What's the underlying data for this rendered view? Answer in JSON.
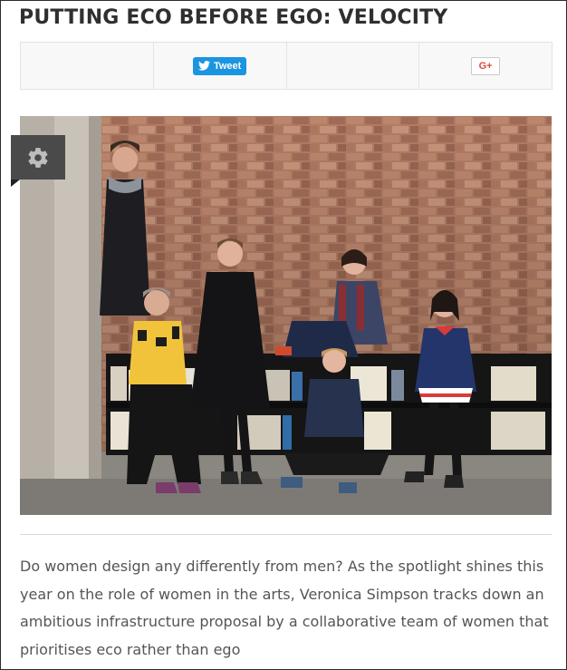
{
  "article": {
    "title": "PUTTING ECO BEFORE EGO: VELOCITY",
    "summary": "Do women design any differently from men? As the spotlight shines this year on the role of women in the arts, Veronica Simpson tracks down an ambitious infrastructure proposal by a collaborative team of women that prioritises eco rather than ego"
  },
  "share_bar": {
    "tweet_label": "Tweet",
    "gplus_label": "G+"
  },
  "icons": {
    "twitter": "twitter-bird-icon",
    "settings": "gear-icon"
  },
  "colors": {
    "tweet_button": "#1b95e0",
    "gplus_text": "#dd4b39",
    "settings_tab": "#4a4a4a"
  }
}
